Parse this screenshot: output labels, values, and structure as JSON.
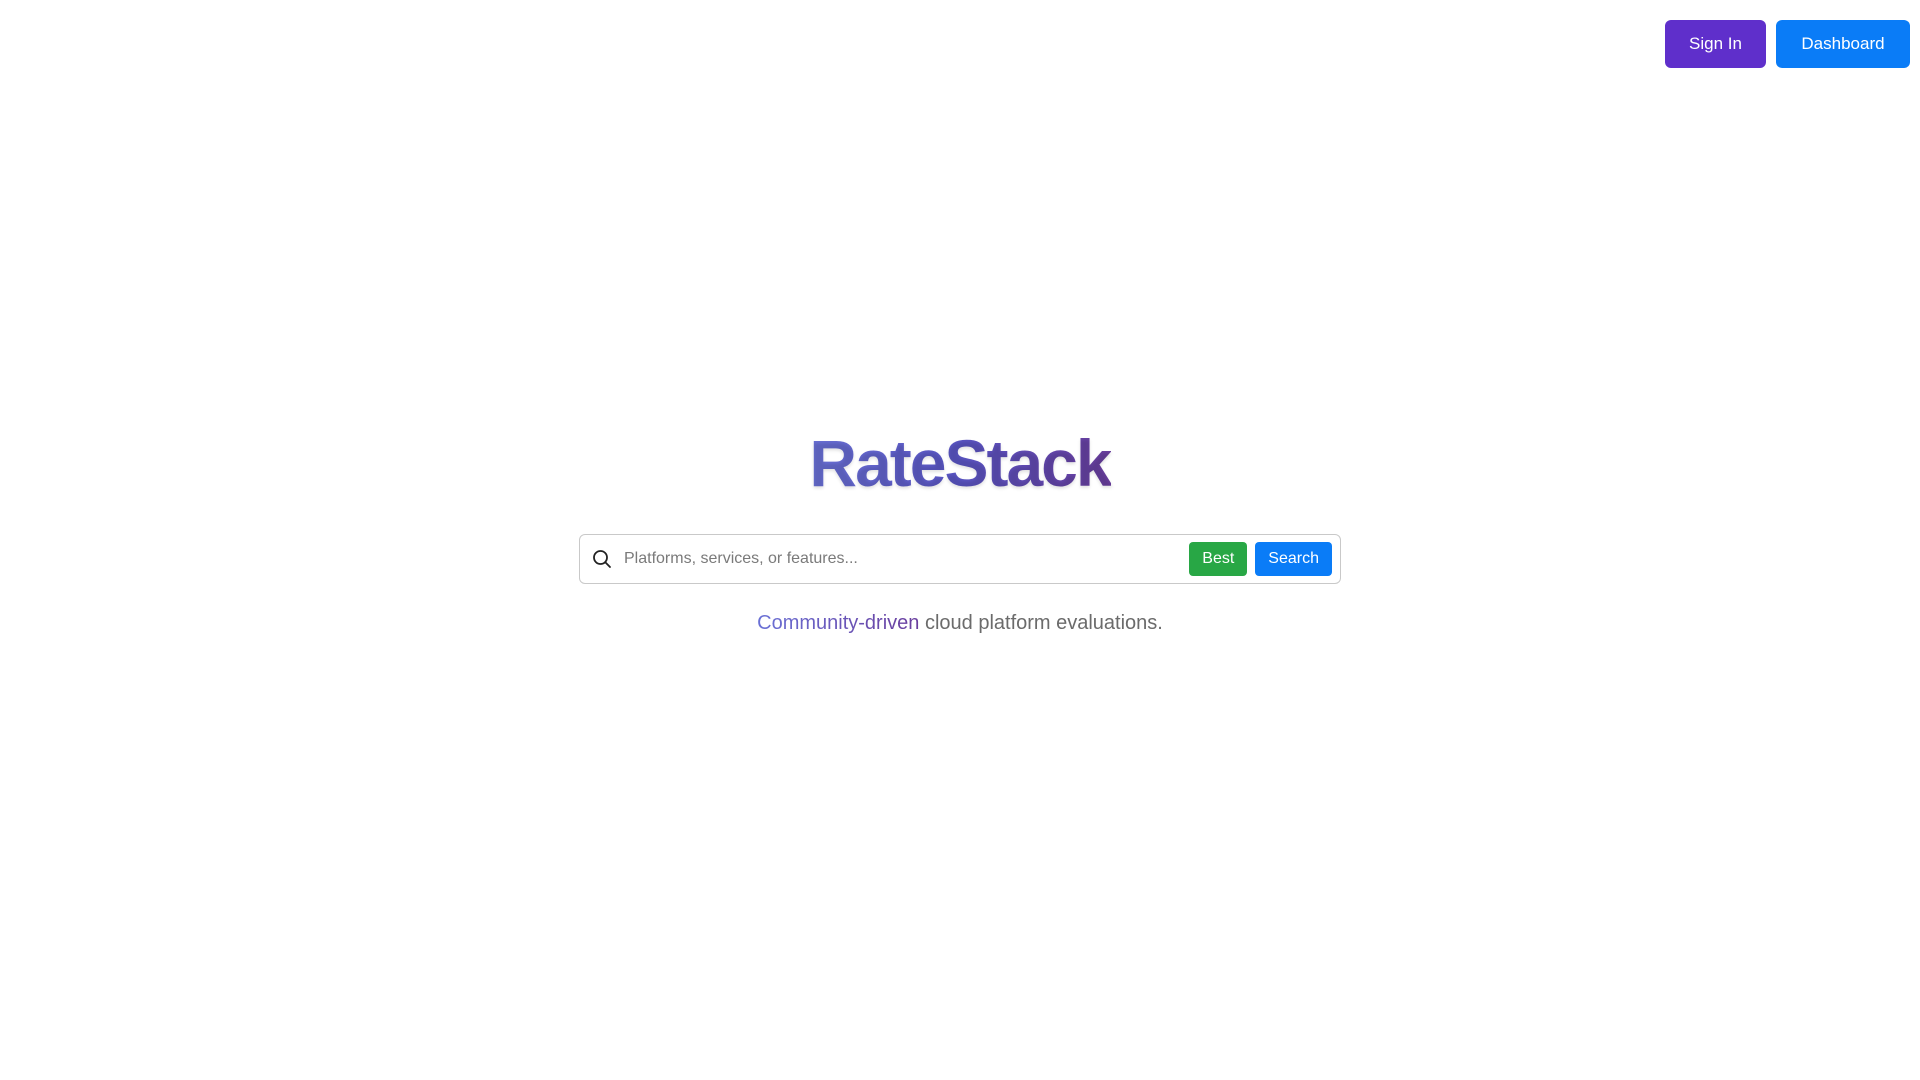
{
  "header": {
    "signin_label": "Sign In",
    "dashboard_label": "Dashboard"
  },
  "brand": {
    "logo_text": "RateStack"
  },
  "search": {
    "placeholder": "Platforms, services, or features...",
    "value": "",
    "best_label": "Best",
    "search_label": "Search",
    "icon": "search-icon"
  },
  "tagline": {
    "highlight": "Community-driven",
    "rest": " cloud platform evaluations."
  },
  "colors": {
    "signin_bg": "#5f2fcb",
    "dashboard_bg": "#0a7cf7",
    "best_bg": "#28a745",
    "search_bg": "#0a7cf7",
    "logo_gradient_start": "#6a71d6",
    "logo_gradient_end": "#6a3e9e"
  }
}
